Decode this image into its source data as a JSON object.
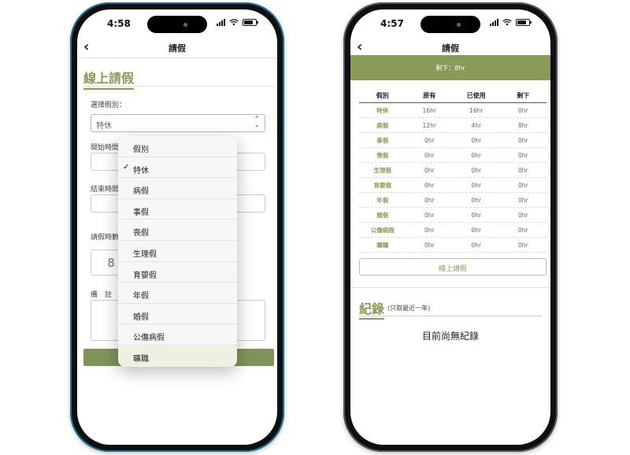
{
  "left_phone": {
    "status_time": "4:58",
    "nav_title": "請假",
    "form_title": "線上請假",
    "leave_type_label": "選擇假別：",
    "leave_type_value": "特休",
    "start_label": "開始時間",
    "end_label": "結束時間",
    "hours_label": "請假時數",
    "hours_value": "8",
    "notes_label": "備　註",
    "dropdown": {
      "selected": "特休",
      "options": [
        "假別",
        "特休",
        "病假",
        "事假",
        "喪假",
        "生理假",
        "育嬰假",
        "年假",
        "婚假",
        "公傷病假",
        "曠職"
      ]
    }
  },
  "right_phone": {
    "status_time": "4:57",
    "nav_title": "請假",
    "banner": "剩下：8hr",
    "table": {
      "headers": [
        "假別",
        "原有",
        "已使用",
        "剩下"
      ],
      "rows": [
        [
          "特休",
          "16hr",
          "16hr",
          "0hr"
        ],
        [
          "病假",
          "12hr",
          "4hr",
          "8hr"
        ],
        [
          "事假",
          "0hr",
          "0hr",
          "0hr"
        ],
        [
          "喪假",
          "0hr",
          "0hr",
          "0hr"
        ],
        [
          "生理假",
          "0hr",
          "0hr",
          "0hr"
        ],
        [
          "育嬰假",
          "0hr",
          "0hr",
          "0hr"
        ],
        [
          "年假",
          "0hr",
          "0hr",
          "0hr"
        ],
        [
          "婚假",
          "0hr",
          "0hr",
          "0hr"
        ],
        [
          "公傷病假",
          "0hr",
          "0hr",
          "0hr"
        ],
        [
          "曠職",
          "0hr",
          "0hr",
          "0hr"
        ]
      ]
    },
    "apply_button": "線上請假",
    "records_title": "紀錄",
    "records_subtitle": "(只取最近一年)",
    "empty_message": "目前尚無紀錄"
  },
  "colors": {
    "accent": "#8a9a5b",
    "accent_dark": "#7f935a"
  }
}
